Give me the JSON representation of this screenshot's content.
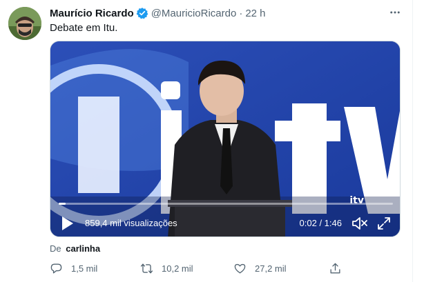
{
  "tweet": {
    "author_name": "Maurício Ricardo",
    "handle": "@MauricioRicardo",
    "separator": "·",
    "time": "22 h",
    "text": "Debate em Itu."
  },
  "video": {
    "views": "859,4 mil visualizações",
    "timecode": "0:02 / 1:46",
    "progress": 0.02,
    "channel_logo": "itv"
  },
  "attribution": {
    "prefix": "De",
    "user": "carlinha"
  },
  "actions": {
    "reply_count": "1,5 mil",
    "retweet_count": "10,2 mil",
    "like_count": "27,2 mil"
  },
  "colors": {
    "accent": "#1d9bf0",
    "muted": "#536471"
  }
}
